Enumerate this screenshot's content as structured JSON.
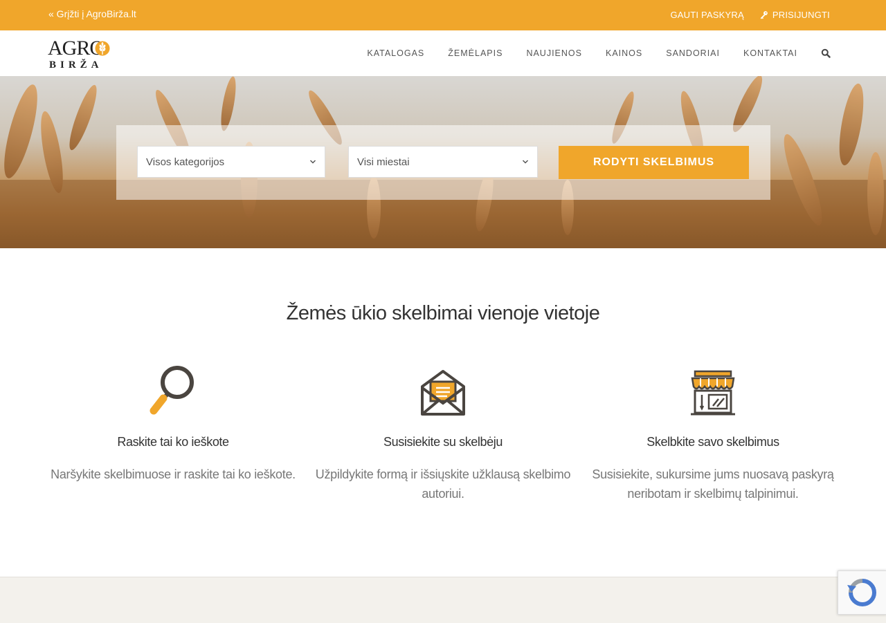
{
  "topbar": {
    "back_link": "« Grįžti į AgroBirža.lt",
    "get_account": "GAUTI PASKYRĄ",
    "login": "PRISIJUNGTI",
    "background_color": "#f0a62b"
  },
  "logo": {
    "line1": "AGRO",
    "line2": "BIRŽA"
  },
  "nav": {
    "items": [
      "KATALOGAS",
      "ŽEMĖLAPIS",
      "NAUJIENOS",
      "KAINOS",
      "SANDORIAI",
      "KONTAKTAI"
    ],
    "search_icon": "search-icon"
  },
  "search": {
    "category_select": "Visos kategorijos",
    "city_select": "Visi miestai",
    "submit_label": "RODYTI SKELBIMUS"
  },
  "main": {
    "title": "Žemės ūkio skelbimai vienoje vietoje",
    "features": [
      {
        "icon": "magnifier-icon",
        "title": "Raskite tai ko ieškote",
        "desc": "Naršykite skelbimuose ir raskite tai ko ieškote."
      },
      {
        "icon": "envelope-icon",
        "title": "Susisiekite su skelbėju",
        "desc": "Užpildykite formą ir išsiųskite užklausą skelbimo autoriui."
      },
      {
        "icon": "shop-icon",
        "title": "Skelbkite savo skelbimus",
        "desc": "Susisiekite, sukursime jums nuosavą paskyrą neribotam ir skelbimų talpinimui."
      }
    ]
  },
  "colors": {
    "accent": "#f0a62b",
    "dark_icon": "#4a4540"
  }
}
